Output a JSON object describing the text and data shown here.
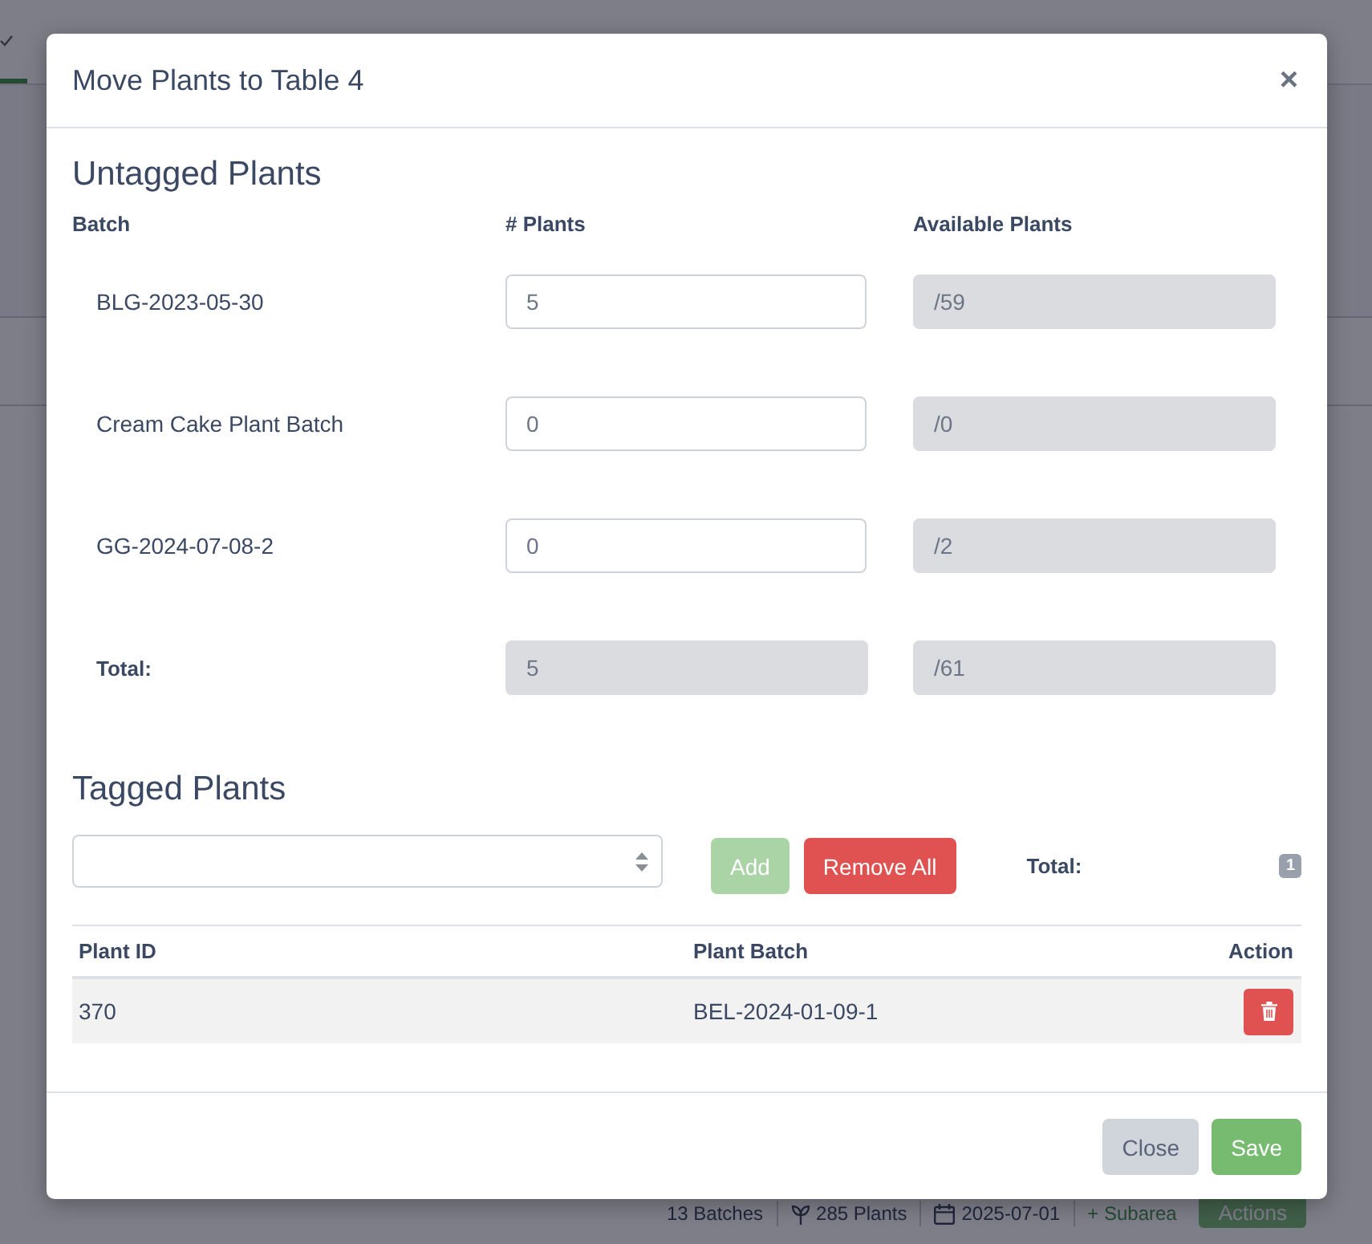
{
  "background": {
    "status_bar": [
      {
        "kind": "text",
        "text": "13 Batches"
      },
      {
        "kind": "plants",
        "text": "285 Plants"
      },
      {
        "kind": "date",
        "text": "2025-07-01"
      },
      {
        "kind": "link",
        "text": "+ Subarea"
      },
      {
        "kind": "button",
        "text": "Actions"
      }
    ]
  },
  "dialog": {
    "title": "Move Plants to Table 4",
    "close": "×",
    "untagged": {
      "heading": "Untagged Plants",
      "columns": [
        "Batch",
        "# Plants",
        "Available Plants"
      ],
      "rows": [
        {
          "batch": "BLG-2023-05-30",
          "plants": "5",
          "available": "/59"
        },
        {
          "batch": "Cream Cake Plant Batch",
          "plants": "0",
          "available": "/0"
        },
        {
          "batch": "GG-2024-07-08-2",
          "plants": "0",
          "available": "/2"
        }
      ],
      "total": {
        "label": "Total:",
        "plants": "5",
        "available": "/61"
      }
    },
    "tagged": {
      "heading": "Tagged Plants",
      "buttons": [
        {
          "label": "Add",
          "kind": "success",
          "disabled": true
        },
        {
          "label": "Remove All",
          "kind": "danger",
          "disabled": false
        }
      ],
      "total_label": "Total:",
      "total_count": "1",
      "table": {
        "columns": [
          "Plant ID",
          "Plant Batch",
          "Action"
        ],
        "rows": [
          {
            "plant_id": "370",
            "plant_batch": "BEL-2024-01-09-1"
          }
        ]
      }
    },
    "footer_buttons": [
      {
        "label": "Close",
        "kind": "secondary"
      },
      {
        "label": "Save",
        "kind": "success"
      }
    ]
  }
}
